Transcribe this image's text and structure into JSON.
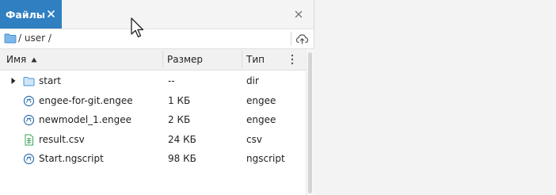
{
  "tab": {
    "label": "Файлы"
  },
  "path": {
    "text": "/ user /"
  },
  "columns": {
    "name": "Имя",
    "size": "Размер",
    "type": "Тип"
  },
  "files": [
    {
      "name": "start",
      "size": "--",
      "type": "dir",
      "icon": "folder-icon"
    },
    {
      "name": "engee-for-git.engee",
      "size": "1 КБ",
      "type": "engee",
      "icon": "engee-file-icon"
    },
    {
      "name": "newmodel_1.engee",
      "size": "2 КБ",
      "type": "engee",
      "icon": "engee-file-icon"
    },
    {
      "name": "result.csv",
      "size": "24 КБ",
      "type": "csv",
      "icon": "csv-file-icon"
    },
    {
      "name": "Start.ngscript",
      "size": "98 КБ",
      "type": "ngscript",
      "icon": "ngscript-file-icon"
    }
  ],
  "colors": {
    "accent": "#2f7fc1",
    "folder": "#6fb0e6",
    "csv": "#3aa55a"
  }
}
